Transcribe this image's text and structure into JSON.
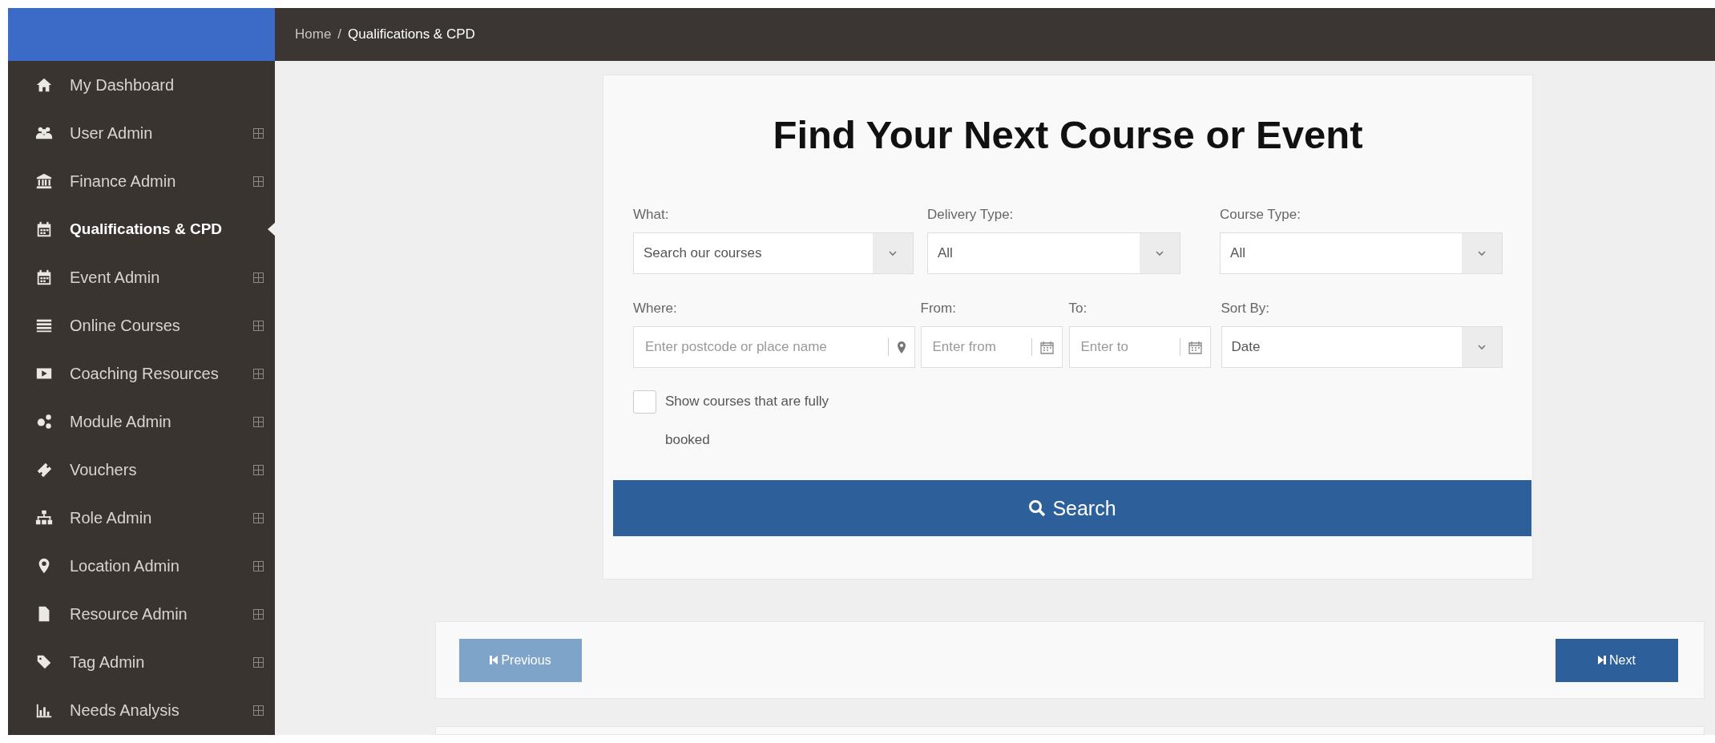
{
  "sidebar": {
    "items": [
      {
        "label": "My Dashboard",
        "expandable": false,
        "selected": false
      },
      {
        "label": "User Admin",
        "expandable": true,
        "selected": false
      },
      {
        "label": "Finance Admin",
        "expandable": true,
        "selected": false
      },
      {
        "label": "Qualifications & CPD",
        "expandable": false,
        "selected": true
      },
      {
        "label": "Event Admin",
        "expandable": true,
        "selected": false
      },
      {
        "label": "Online Courses",
        "expandable": true,
        "selected": false
      },
      {
        "label": "Coaching Resources",
        "expandable": true,
        "selected": false
      },
      {
        "label": "Module Admin",
        "expandable": true,
        "selected": false
      },
      {
        "label": "Vouchers",
        "expandable": true,
        "selected": false
      },
      {
        "label": "Role Admin",
        "expandable": true,
        "selected": false
      },
      {
        "label": "Location Admin",
        "expandable": true,
        "selected": false
      },
      {
        "label": "Resource Admin",
        "expandable": true,
        "selected": false
      },
      {
        "label": "Tag Admin",
        "expandable": true,
        "selected": false
      },
      {
        "label": "Needs Analysis",
        "expandable": true,
        "selected": false
      }
    ]
  },
  "breadcrumb": {
    "separator": "/",
    "items": [
      {
        "label": "Home"
      },
      {
        "label": "Qualifications & CPD"
      }
    ]
  },
  "search_form": {
    "title": "Find Your Next Course or Event",
    "fields": [
      {
        "kind": "select",
        "label": "What:",
        "value": "Search our courses"
      },
      {
        "kind": "select",
        "label": "Delivery Type:",
        "value": "All"
      },
      {
        "kind": "select",
        "label": "Course Type:",
        "value": "All"
      },
      {
        "kind": "location",
        "label": "Where:",
        "placeholder": "Enter postcode or place name"
      },
      {
        "kind": "date",
        "label": "From:",
        "placeholder": "Enter from"
      },
      {
        "kind": "date",
        "label": "To:",
        "placeholder": "Enter to"
      },
      {
        "kind": "select",
        "label": "Sort By:",
        "value": "Date"
      }
    ],
    "checkbox": {
      "label": "Show courses that are fully booked",
      "checked": false
    },
    "search_button": "Search"
  },
  "pager": {
    "previous": {
      "label": "Previous",
      "disabled": true
    },
    "next": {
      "label": "Next",
      "disabled": false
    }
  }
}
